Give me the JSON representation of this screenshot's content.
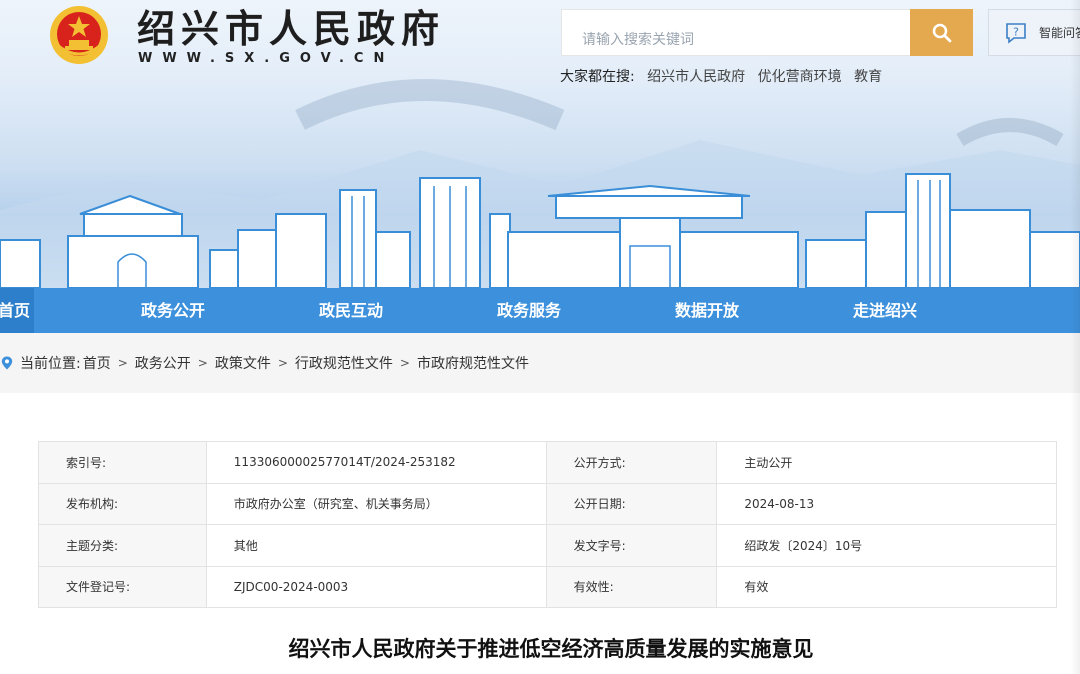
{
  "header": {
    "site_title": "绍兴市人民政府",
    "site_domain": "WWW.SX.GOV.CN",
    "search_placeholder": "请输入搜索关键词",
    "hot_label": "大家都在搜:",
    "hot_keywords": [
      "绍兴市人民政府",
      "优化营商环境",
      "教育"
    ],
    "smart_label": "智能问答"
  },
  "nav": {
    "items": [
      "首页",
      "政务公开",
      "政民互动",
      "政务服务",
      "数据开放",
      "走进绍兴"
    ]
  },
  "breadcrumb": {
    "label": "当前位置:",
    "items": [
      "首页",
      "政务公开",
      "政策文件",
      "行政规范性文件",
      "市政府规范性文件"
    ]
  },
  "meta": {
    "rows": [
      {
        "k1": "索引号:",
        "v1": "11330600002577014T/2024-253182",
        "k2": "公开方式:",
        "v2": "主动公开"
      },
      {
        "k1": "发布机构:",
        "v1": "市政府办公室（研究室、机关事务局）",
        "k2": "公开日期:",
        "v2": "2024-08-13"
      },
      {
        "k1": "主题分类:",
        "v1": "其他",
        "k2": "发文字号:",
        "v2": "绍政发〔2024〕10号"
      },
      {
        "k1": "文件登记号:",
        "v1": "ZJDC00-2024-0003",
        "k2": "有效性:",
        "v2": "有效"
      }
    ]
  },
  "document": {
    "title": "绍兴市人民政府关于推进低空经济高质量发展的实施意见"
  },
  "colors": {
    "nav_bg": "#3d91dc",
    "search_button": "#e4a84e",
    "emblem_red": "#d8231c",
    "emblem_gold": "#f2c032"
  },
  "icons": {
    "search": "search-icon",
    "smart": "chat-question-icon",
    "location": "location-pin-icon",
    "emblem": "national-emblem-icon"
  }
}
